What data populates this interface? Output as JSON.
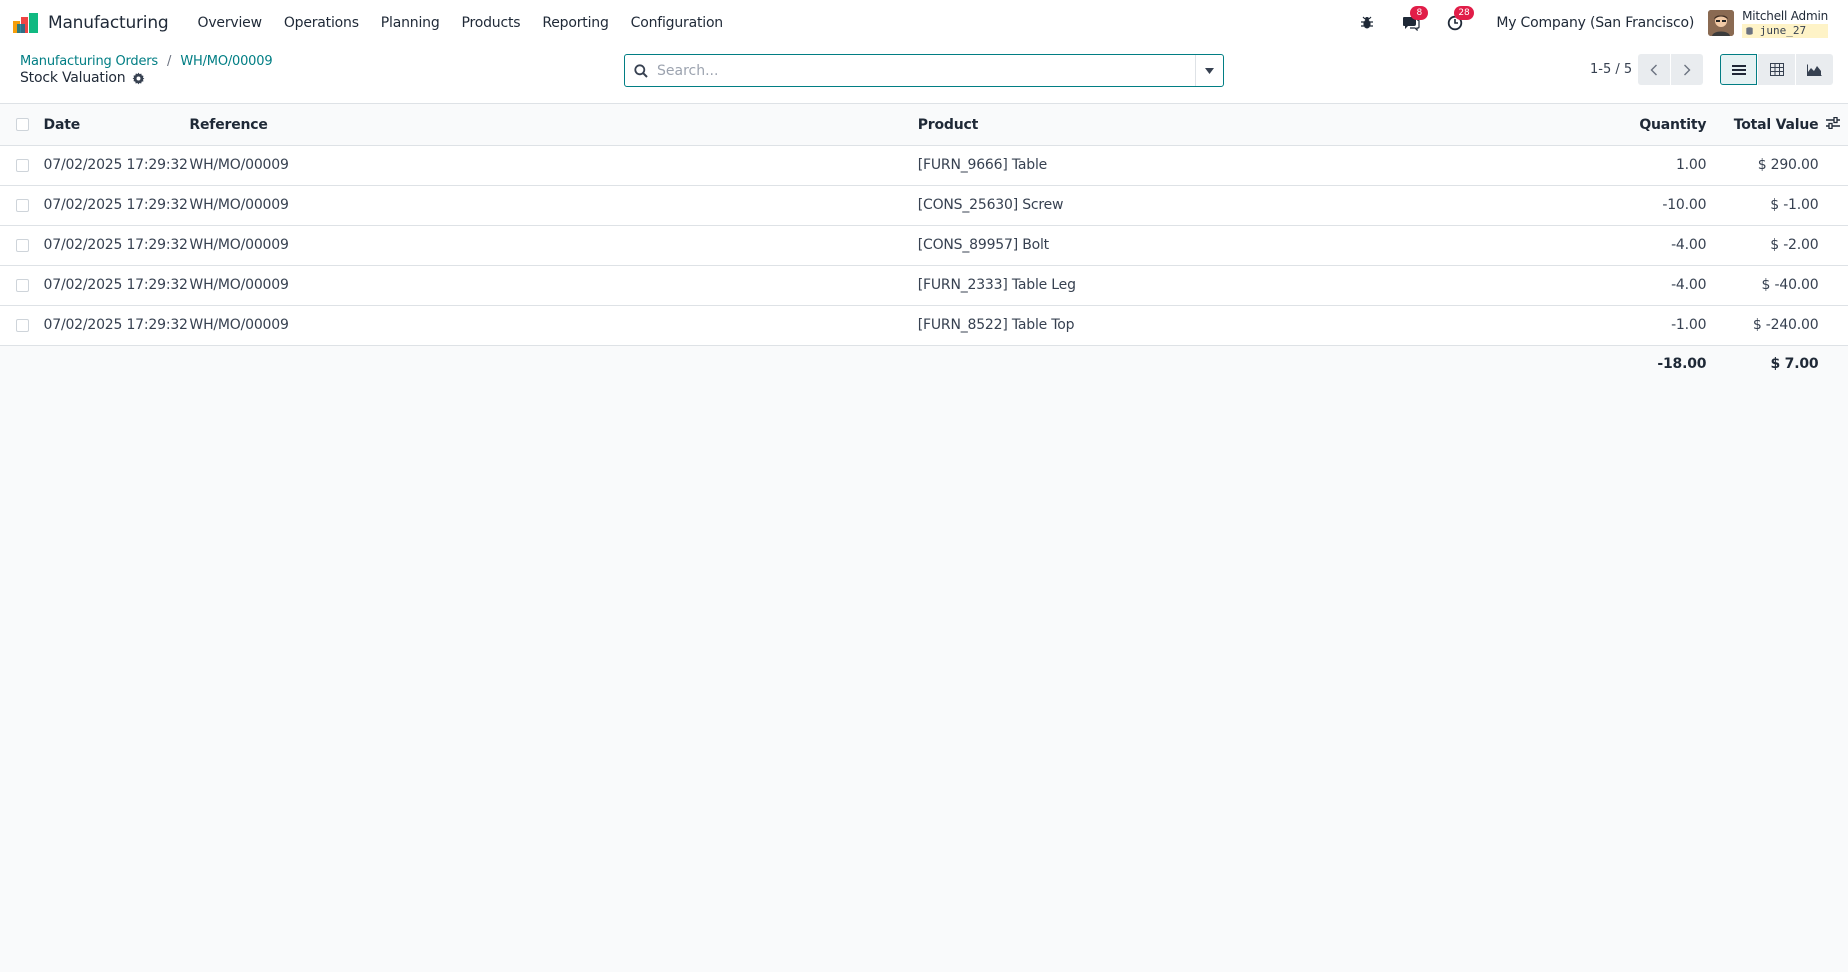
{
  "app": {
    "name": "Manufacturing"
  },
  "menu": [
    "Overview",
    "Operations",
    "Planning",
    "Products",
    "Reporting",
    "Configuration"
  ],
  "systray": {
    "messages_badge": "8",
    "activities_badge": "28",
    "company": "My Company (San Francisco)",
    "user_name": "Mitchell Admin",
    "database": "june_27"
  },
  "breadcrumb": [
    "Manufacturing Orders",
    "WH/MO/00009"
  ],
  "page": {
    "title": "Stock Valuation"
  },
  "search": {
    "placeholder": "Search..."
  },
  "pager": {
    "text": "1-5 / 5"
  },
  "table": {
    "columns": [
      "Date",
      "Reference",
      "Product",
      "Quantity",
      "Total Value"
    ],
    "rows": [
      {
        "date": "07/02/2025 17:29:32",
        "reference": "WH/MO/00009",
        "product": "[FURN_9666] Table",
        "quantity": "1.00",
        "value": "$ 290.00"
      },
      {
        "date": "07/02/2025 17:29:32",
        "reference": "WH/MO/00009",
        "product": "[CONS_25630] Screw",
        "quantity": "-10.00",
        "value": "$ -1.00"
      },
      {
        "date": "07/02/2025 17:29:32",
        "reference": "WH/MO/00009",
        "product": "[CONS_89957] Bolt",
        "quantity": "-4.00",
        "value": "$ -2.00"
      },
      {
        "date": "07/02/2025 17:29:32",
        "reference": "WH/MO/00009",
        "product": "[FURN_2333] Table Leg",
        "quantity": "-4.00",
        "value": "$ -40.00"
      },
      {
        "date": "07/02/2025 17:29:32",
        "reference": "WH/MO/00009",
        "product": "[FURN_8522] Table Top",
        "quantity": "-1.00",
        "value": "$ -240.00"
      }
    ],
    "totals": {
      "quantity": "-18.00",
      "value": "$ 7.00"
    }
  },
  "colors": {
    "accent": "#017e84",
    "badge": "#e11d48"
  }
}
